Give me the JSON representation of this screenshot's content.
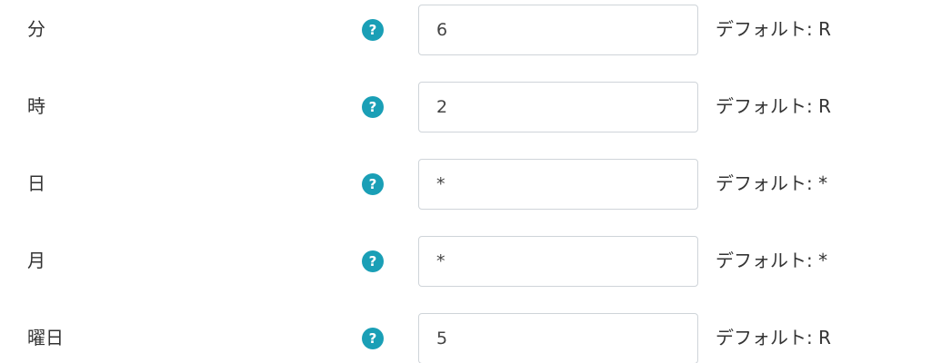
{
  "colors": {
    "help_icon_bg": "#1a9fb6",
    "input_border": "#cfd4d9",
    "text": "#333333"
  },
  "help_icon_glyph": "?",
  "rows": [
    {
      "label": "分",
      "value": "6",
      "default_text": "デフォルト: R"
    },
    {
      "label": "時",
      "value": "2",
      "default_text": "デフォルト: R"
    },
    {
      "label": "日",
      "value": "*",
      "default_text": "デフォルト: *"
    },
    {
      "label": "月",
      "value": "*",
      "default_text": "デフォルト: *"
    },
    {
      "label": "曜日",
      "value": "5",
      "default_text": "デフォルト: R"
    }
  ]
}
